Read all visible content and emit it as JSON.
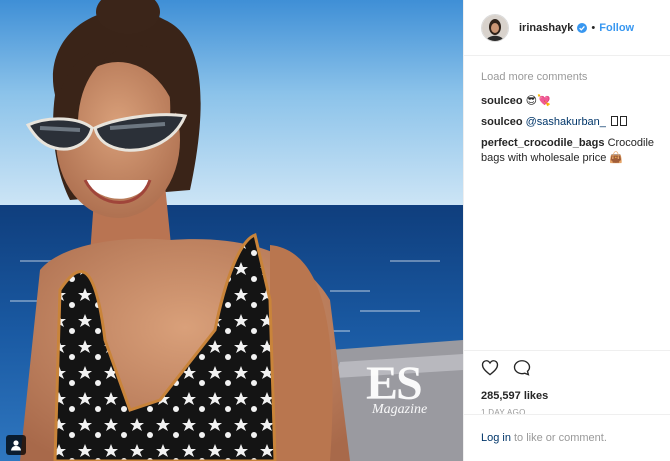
{
  "post": {
    "username": "irinashayk",
    "follow_label": "Follow",
    "separator": "•",
    "watermark": {
      "title": "ES",
      "subtitle": "Magazine"
    }
  },
  "comments": {
    "load_more": "Load more comments",
    "items": [
      {
        "user": "soulceo",
        "text": "😎💘"
      },
      {
        "user": "soulceo",
        "mention": "@sashakurban_",
        "text": ""
      },
      {
        "user": "perfect_crocodile_bags",
        "text": "Crocodile bags with wholesale price 👜"
      }
    ]
  },
  "footer": {
    "likes": "285,597 likes",
    "time": "1 DAY AGO",
    "login_link": "Log in",
    "login_text": "to like or comment."
  },
  "colors": {
    "link_blue": "#3897f0",
    "mention_dark": "#003569",
    "muted": "#999999",
    "text": "#262626"
  },
  "icons": [
    "verified-badge-icon",
    "heart-icon",
    "comment-icon",
    "user-tag-icon"
  ]
}
